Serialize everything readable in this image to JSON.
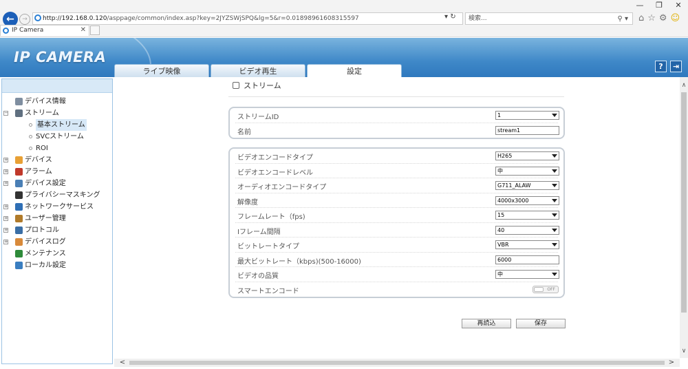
{
  "browser": {
    "window_controls": [
      "—",
      "❐",
      "✕"
    ],
    "url_host": "http://192.168.0.120",
    "url_path": "/asppage/common/index.asp?key=2JYZSWjSPQ&lg=5&r=0.01898961608315597",
    "addr_controls": "▾ ↻",
    "search_placeholder": "検索...",
    "search_icon": "⚲ ▾",
    "toolbar_icons": {
      "home": "⌂",
      "star": "☆",
      "gear": "⚙",
      "smile": "☺"
    },
    "tab_title": "IP Camera",
    "tab_close": "✕",
    "back_glyph": "←",
    "forward_glyph": "→"
  },
  "header": {
    "logo": "IP CAMERA",
    "tabs": [
      {
        "label": "ライブ映像",
        "active": false
      },
      {
        "label": "ビデオ再生",
        "active": false
      },
      {
        "label": "設定",
        "active": true
      }
    ],
    "help_glyph": "?",
    "logout_glyph": "⇥"
  },
  "sidebar": {
    "items": [
      {
        "label": "デバイス情報",
        "icon": "device-info-icon",
        "color": "#7f8ea0"
      },
      {
        "label": "ストリーム",
        "icon": "stream-icon",
        "color": "#607080",
        "expander": "−"
      },
      {
        "label": "基本ストリーム",
        "icon": "dot-icon",
        "selected": true
      },
      {
        "label": "SVCストリーム",
        "icon": "dot-icon"
      },
      {
        "label": "ROI",
        "icon": "dot-icon"
      },
      {
        "label": "デバイス",
        "icon": "device-icon",
        "color": "#e8a035",
        "expander": "+"
      },
      {
        "label": "アラーム",
        "icon": "alarm-icon",
        "color": "#c0392b",
        "expander": "+"
      },
      {
        "label": "デバイス設定",
        "icon": "device-settings-icon",
        "color": "#4a7fb5",
        "expander": "+"
      },
      {
        "label": "プライバシーマスキング",
        "icon": "privacy-mask-icon",
        "color": "#333333"
      },
      {
        "label": "ネットワークサービス",
        "icon": "network-icon",
        "color": "#2f6fb5",
        "expander": "+"
      },
      {
        "label": "ユーザー管理",
        "icon": "user-icon",
        "color": "#b07a2a",
        "expander": "+"
      },
      {
        "label": "プロトコル",
        "icon": "protocol-icon",
        "color": "#3a6ea5",
        "expander": "+"
      },
      {
        "label": "デバイスログ",
        "icon": "log-icon",
        "color": "#d88a3a",
        "expander": "+"
      },
      {
        "label": "メンテナンス",
        "icon": "maintenance-icon",
        "color": "#2e8b3a"
      },
      {
        "label": "ローカル設定",
        "icon": "local-settings-icon",
        "color": "#3a7ec0"
      }
    ]
  },
  "main": {
    "breadcrumb": "ストリーム",
    "panel1": [
      {
        "label": "ストリームID",
        "type": "select",
        "value": "1"
      },
      {
        "label": "名前",
        "type": "text",
        "value": "stream1"
      }
    ],
    "panel2": [
      {
        "label": "ビデオエンコードタイプ",
        "type": "select",
        "value": "H265"
      },
      {
        "label": "ビデオエンコードレベル",
        "type": "select",
        "value": "中"
      },
      {
        "label": "オーディオエンコードタイプ",
        "type": "select",
        "value": "G711_ALAW"
      },
      {
        "label": "解像度",
        "type": "select",
        "value": "4000x3000"
      },
      {
        "label": "フレームレート（fps)",
        "type": "select",
        "value": "15"
      },
      {
        "label": "Iフレーム間隔",
        "type": "select",
        "value": "40"
      },
      {
        "label": "ビットレートタイプ",
        "type": "select",
        "value": "VBR"
      },
      {
        "label": "最大ビットレート（kbps)(500-16000)",
        "type": "text",
        "value": "6000"
      },
      {
        "label": "ビデオの品質",
        "type": "select",
        "value": "中"
      },
      {
        "label": "スマートエンコード",
        "type": "toggle",
        "value": "OFF"
      }
    ],
    "reload_label": "再読込",
    "save_label": "保存"
  },
  "scroll": {
    "up": "∧",
    "down": "∨",
    "left": "<",
    "right": ">"
  }
}
